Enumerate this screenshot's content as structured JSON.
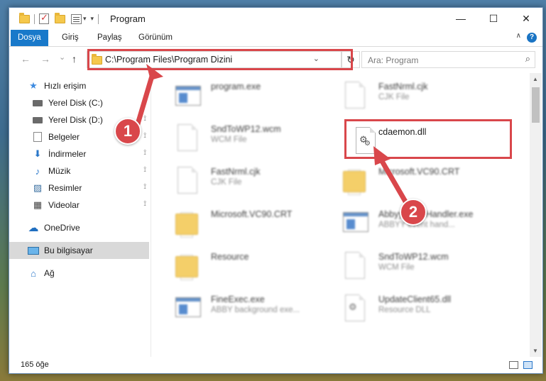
{
  "window": {
    "title": "Program",
    "min_glyph": "—",
    "max_glyph": "☐",
    "close_glyph": "✕"
  },
  "ribbon": {
    "tabs": [
      "Dosya",
      "Giriş",
      "Paylaş",
      "Görünüm"
    ],
    "active_tab": "Dosya",
    "help_glyph": "?",
    "collapse_glyph": "∧"
  },
  "nav": {
    "back_glyph": "←",
    "forward_glyph": "→",
    "recent_glyph": "⌄",
    "up_glyph": "↑",
    "address_path": "C:\\Program Files\\Program Dizini",
    "dropdown_glyph": "⌄",
    "refresh_glyph": "↻",
    "search_placeholder": "Ara: Program",
    "search_glyph": "⌕"
  },
  "sidebar": {
    "items": [
      {
        "label": "Hızlı erişim",
        "icon": "star-icon",
        "glyph": "★",
        "pinned": false
      },
      {
        "label": "Yerel Disk (C:)",
        "icon": "drive-icon",
        "glyph": "",
        "pinned": true
      },
      {
        "label": "Yerel Disk (D:)",
        "icon": "drive-icon",
        "glyph": "",
        "pinned": true
      },
      {
        "label": "Belgeler",
        "icon": "documents-icon",
        "glyph": "",
        "pinned": true
      },
      {
        "label": "İndirmeler",
        "icon": "download-icon",
        "glyph": "⬇",
        "pinned": true
      },
      {
        "label": "Müzik",
        "icon": "music-icon",
        "glyph": "♪",
        "pinned": true
      },
      {
        "label": "Resimler",
        "icon": "pictures-icon",
        "glyph": "▨",
        "pinned": true
      },
      {
        "label": "Videolar",
        "icon": "videos-icon",
        "glyph": "▦",
        "pinned": true
      },
      {
        "label": "OneDrive",
        "icon": "cloud-icon",
        "glyph": "☁",
        "pinned": false
      },
      {
        "label": "Bu bilgisayar",
        "icon": "computer-icon",
        "glyph": "",
        "pinned": false
      },
      {
        "label": "Ağ",
        "icon": "network-icon",
        "glyph": "⌂",
        "pinned": false
      }
    ],
    "selected": "Bu bilgisayar",
    "pin_glyph": "📌"
  },
  "files": [
    {
      "name": "program.exe",
      "type": "",
      "icon": "exe-icon"
    },
    {
      "name": "FastNrml.cjk",
      "type": "CJK File",
      "icon": "file-icon"
    },
    {
      "name": "SndToWP12.wcm",
      "type": "WCM File",
      "icon": "file-icon"
    },
    {
      "name": "cdaemon.dll",
      "type": "",
      "icon": "dll-icon"
    },
    {
      "name": "FastNrml.cjk",
      "type": "CJK File",
      "icon": "file-icon"
    },
    {
      "name": "Microsoft.VC90.CRT",
      "type": "",
      "icon": "folder-icon"
    },
    {
      "name": "Microsoft.VC90.CRT",
      "type": "",
      "icon": "folder-icon"
    },
    {
      "name": "AbbyyEventHandler.exe",
      "type": "ABBYY event hand...",
      "icon": "exe-icon"
    },
    {
      "name": "Resource",
      "type": "",
      "icon": "folder-icon"
    },
    {
      "name": "SndToWP12.wcm",
      "type": "WCM File",
      "icon": "file-icon"
    },
    {
      "name": "FineExec.exe",
      "type": "ABBY background exe...",
      "icon": "exe-icon"
    },
    {
      "name": "UpdateClient65.dll",
      "type": "Resource DLL",
      "icon": "dll-icon"
    }
  ],
  "status": {
    "item_count": "165 öğe"
  },
  "callouts": [
    "1",
    "2"
  ],
  "colors": {
    "accent": "#1979ca",
    "highlight_red": "#d9474b",
    "folder_yellow": "#f3c74f"
  }
}
